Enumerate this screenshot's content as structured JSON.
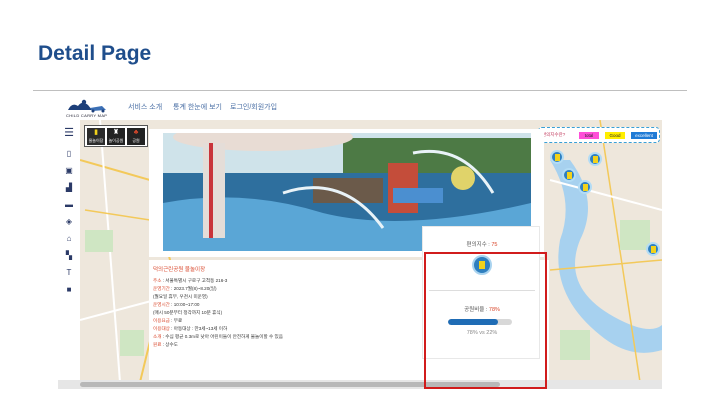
{
  "slide": {
    "title": "Detail Page"
  },
  "header": {
    "logo_text": "CHILD CARRY MAP",
    "nav": [
      "서비스 소개",
      "통계 한눈에 보기",
      "로그인/회원가입"
    ]
  },
  "categories": [
    {
      "label": "물놀이장",
      "icon": "water-play-icon"
    },
    {
      "label": "놀이공원",
      "icon": "amusement-icon"
    },
    {
      "label": "공원",
      "icon": "park-icon"
    }
  ],
  "legend": {
    "label": "편의지수란?",
    "items": [
      {
        "label": "total",
        "color": "#ff4fd8"
      },
      {
        "label": "Good",
        "color": "#ffee00"
      },
      {
        "label": "excellent",
        "color": "#1f7bd6"
      }
    ]
  },
  "detail": {
    "title": "덕의근린공원 물놀이장",
    "lines": [
      {
        "key": "주소",
        "value": "서울특별시 구로구 고척동 216-3"
      },
      {
        "key": "운영기간",
        "value": "2023.7월(8)~8.20(일)"
      },
      {
        "key": "",
        "value": "(월요일 휴무, 우천시 미운영)"
      },
      {
        "key": "운영시간",
        "value": "10:00~17:00"
      },
      {
        "key": "",
        "value": "(매시 50분부터 정각까지 10분 휴식)"
      },
      {
        "key": "이용요금",
        "value": "무료"
      },
      {
        "key": "이용대상",
        "value": "아동대상 : 만3세~13세 이하"
      },
      {
        "key": "소개",
        "value": "수심 평균 0.3m로 낮아 어린이들이 안전하게 물놀이할 수 있음"
      },
      {
        "key": "원료",
        "value": "상수도"
      }
    ]
  },
  "stats": {
    "convenience_label": "편의지수 :",
    "convenience_value": "75",
    "ratio_label": "공원비율 :",
    "ratio_value": "78%",
    "ratio_fraction": 0.78,
    "ratio_text": "78% vs 22%"
  },
  "colors": {
    "title": "#1f4e8c",
    "accent": "#d9472b",
    "highlight": "#d11c1c",
    "pin": "#2f7fbf"
  }
}
